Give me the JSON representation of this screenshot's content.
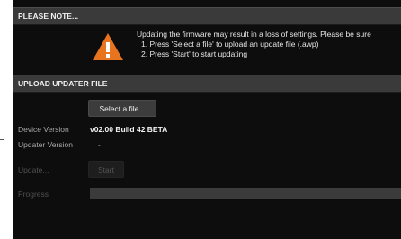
{
  "note": {
    "header": "PLEASE NOTE...",
    "warning_text": "Updating the firmware may result in a loss of settings. Please be sure",
    "step1": "1. Press 'Select a file' to upload an update file (.awp)",
    "step2": "2. Press 'Start' to start updating",
    "icon": "warning-triangle-icon",
    "accent": "#e8741f"
  },
  "upload": {
    "header": "UPLOAD UPDATER FILE",
    "select_button": "Select a file...",
    "device_version_label": "Device Version",
    "device_version_value": "v02.00 Build 42 BETA",
    "updater_version_label": "Updater Version",
    "updater_version_value": "-",
    "update_label": "Update...",
    "start_button": "Start",
    "progress_label": "Progress",
    "progress_percent": 0
  }
}
